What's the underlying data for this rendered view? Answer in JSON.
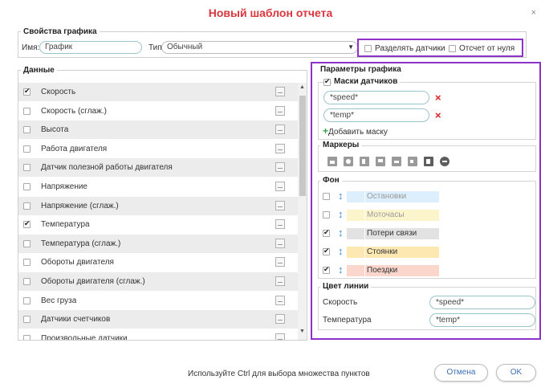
{
  "dialog": {
    "title": "Новый шаблон отчета",
    "close_glyph": "×",
    "hint": "Используйте Ctrl для выбора множества пунктов",
    "cancel_label": "Отмена",
    "ok_label": "OK"
  },
  "props": {
    "legend": "Свойства графика",
    "name_label": "Имя:",
    "name_value": "График",
    "type_label": "Тип:",
    "type_value": "Обычный",
    "split_sensors_label": "Разделять датчики",
    "split_sensors_checked": false,
    "from_zero_label": "Отсчет от нуля",
    "from_zero_checked": false
  },
  "data": {
    "legend": "Данные",
    "items": [
      {
        "label": "Скорость",
        "checked": true
      },
      {
        "label": "Скорость (сглаж.)",
        "checked": false
      },
      {
        "label": "Высота",
        "checked": false
      },
      {
        "label": "Работа двигателя",
        "checked": false
      },
      {
        "label": "Датчик полезной работы двигателя",
        "checked": false
      },
      {
        "label": "Напряжение",
        "checked": false
      },
      {
        "label": "Напряжение (сглаж.)",
        "checked": false
      },
      {
        "label": "Температура",
        "checked": true
      },
      {
        "label": "Температура (сглаж.)",
        "checked": false
      },
      {
        "label": "Обороты двигателя",
        "checked": false
      },
      {
        "label": "Обороты двигателя (сглаж.)",
        "checked": false
      },
      {
        "label": "Вес груза",
        "checked": false
      },
      {
        "label": "Датчики счетчиков",
        "checked": false
      },
      {
        "label": "Произвольные датчики",
        "checked": false
      }
    ]
  },
  "params": {
    "legend": "Параметры графика",
    "masks": {
      "legend": "Маски датчиков",
      "checked": true,
      "items": [
        "*speed*",
        "*temp*"
      ],
      "remove_glyph": "×",
      "add_label": "Добавить маску",
      "add_glyph": "+"
    },
    "markers": {
      "legend": "Маркеры",
      "icons": [
        "fill-marker-icon",
        "stop-marker-icon",
        "fuel-marker-icon",
        "flag-marker-icon",
        "image-marker-icon",
        "video-marker-icon",
        "parking-marker-icon",
        "remove-markers-icon"
      ]
    },
    "background": {
      "legend": "Фон",
      "items": [
        {
          "label": "Остановки",
          "checked": false,
          "disabled": true,
          "color": "#ddeffc"
        },
        {
          "label": "Моточасы",
          "checked": false,
          "disabled": true,
          "color": "#fcf5cc"
        },
        {
          "label": "Потери связи",
          "checked": true,
          "disabled": false,
          "color": "#e2e2e2"
        },
        {
          "label": "Стоянки",
          "checked": true,
          "disabled": false,
          "color": "#fde8b2"
        },
        {
          "label": "Поездки",
          "checked": true,
          "disabled": false,
          "color": "#fbd6cc"
        }
      ]
    },
    "line_color": {
      "legend": "Цвет линии",
      "items": [
        {
          "label": "Скорость",
          "value": "*speed*"
        },
        {
          "label": "Температура",
          "value": "*temp*"
        }
      ]
    }
  },
  "colors": {
    "title": "#d9363e",
    "highlight": "#8f33c8",
    "input_border": "#9bc3cc",
    "remove": "#dd2222",
    "add": "#3aa34a",
    "arrow": "#2f8bd8"
  }
}
